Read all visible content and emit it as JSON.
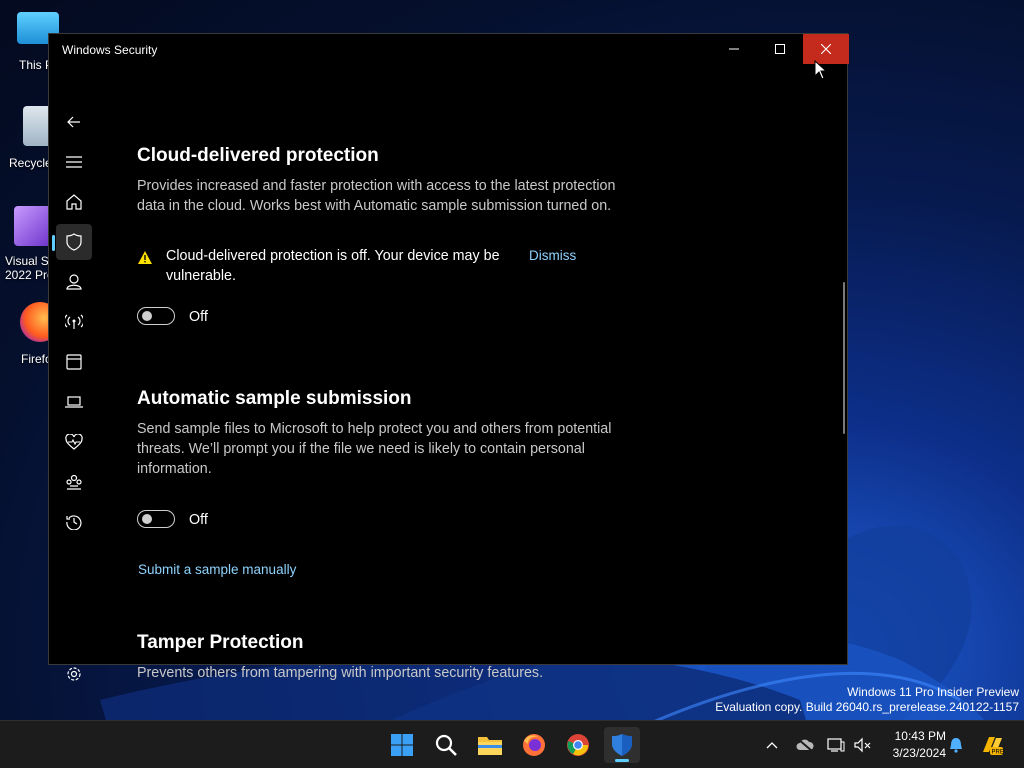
{
  "window": {
    "title": "Windows Security"
  },
  "desktop": {
    "icons": [
      {
        "label": "This P"
      },
      {
        "label": "Recycle"
      },
      {
        "label": "Visual St\n2022 Pre"
      },
      {
        "label": "Firefo"
      }
    ]
  },
  "nav": {
    "items": [
      "back-icon",
      "menu-icon",
      "home-icon",
      "shield-icon",
      "person-icon",
      "wifi-icon",
      "app-browser-icon",
      "device-icon",
      "heart-icon",
      "family-icon",
      "history-icon",
      "settings-icon"
    ],
    "active_index": 3
  },
  "sections": {
    "cloud": {
      "heading": "Cloud-delivered protection",
      "description": "Provides increased and faster protection with access to the latest protection data in the cloud. Works best with Automatic sample submission turned on.",
      "warning": "Cloud-delivered protection is off. Your device may be vulnerable.",
      "dismiss_label": "Dismiss",
      "toggle_label": "Off",
      "toggle_state": false
    },
    "sample": {
      "heading": "Automatic sample submission",
      "description": "Send sample files to Microsoft to help protect you and others from potential threats. We’ll prompt you if the file we need is likely to contain personal information.",
      "toggle_label": "Off",
      "toggle_state": false,
      "manual_link": "Submit a sample manually"
    },
    "tamper": {
      "heading": "Tamper Protection",
      "description": "Prevents others from tampering with important security features."
    }
  },
  "taskbar": {
    "apps": [
      "start-icon",
      "search-icon",
      "file-explorer-icon",
      "firefox-icon",
      "chrome-icon",
      "windows-security-icon"
    ],
    "active_app": "windows-security-icon",
    "time": "10:43 PM",
    "date": "3/23/2024"
  },
  "watermark": {
    "line1": "Windows 11 Pro Insider Preview",
    "line2": "Evaluation copy. Build 26040.rs_prerelease.240122-1157"
  },
  "colors": {
    "accent": "#60cdff",
    "link": "#8fd3ff",
    "close_hover": "#c42b1c",
    "warning": "#fce100"
  }
}
